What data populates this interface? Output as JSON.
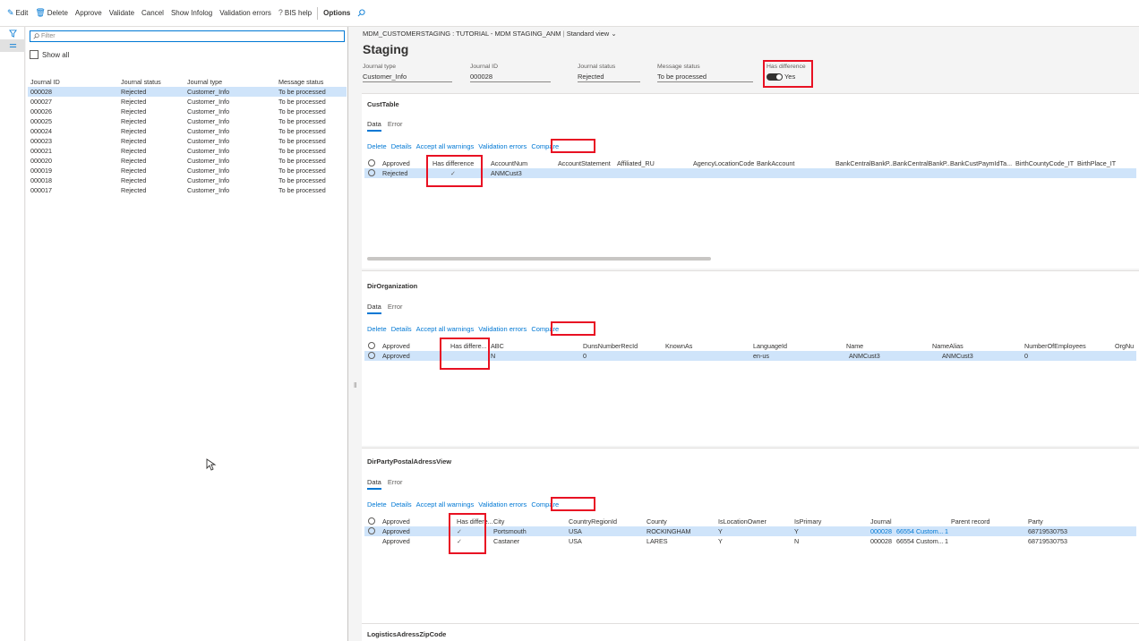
{
  "actions": {
    "edit": "Edit",
    "delete": "Delete",
    "approve": "Approve",
    "validate": "Validate",
    "cancel": "Cancel",
    "show_infolog": "Show Infolog",
    "validation_errors": "Validation errors",
    "bis_help": "BIS help",
    "options": "Options"
  },
  "list": {
    "filter_placeholder": "Filter",
    "show_all": "Show all",
    "columns": [
      "Journal ID",
      "Journal status",
      "Journal type",
      "Message status"
    ],
    "rows": [
      {
        "id": "000028",
        "status": "Rejected",
        "type": "Customer_Info",
        "message": "To be processed"
      },
      {
        "id": "000027",
        "status": "Rejected",
        "type": "Customer_Info",
        "message": "To be processed"
      },
      {
        "id": "000026",
        "status": "Rejected",
        "type": "Customer_Info",
        "message": "To be processed"
      },
      {
        "id": "000025",
        "status": "Rejected",
        "type": "Customer_Info",
        "message": "To be processed"
      },
      {
        "id": "000024",
        "status": "Rejected",
        "type": "Customer_Info",
        "message": "To be processed"
      },
      {
        "id": "000023",
        "status": "Rejected",
        "type": "Customer_Info",
        "message": "To be processed"
      },
      {
        "id": "000021",
        "status": "Rejected",
        "type": "Customer_Info",
        "message": "To be processed"
      },
      {
        "id": "000020",
        "status": "Rejected",
        "type": "Customer_Info",
        "message": "To be processed"
      },
      {
        "id": "000019",
        "status": "Rejected",
        "type": "Customer_Info",
        "message": "To be processed"
      },
      {
        "id": "000018",
        "status": "Rejected",
        "type": "Customer_Info",
        "message": "To be processed"
      },
      {
        "id": "000017",
        "status": "Rejected",
        "type": "Customer_Info",
        "message": "To be processed"
      }
    ]
  },
  "detail": {
    "breadcrumb": "MDM_CUSTOMERSTAGING : TUTORIAL - MDM STAGING_ANM",
    "view": "Standard view",
    "title": "Staging",
    "header": {
      "journal_type_label": "Journal type",
      "journal_type_value": "Customer_Info",
      "journal_id_label": "Journal ID",
      "journal_id_value": "000028",
      "journal_status_label": "Journal status",
      "journal_status_value": "Rejected",
      "message_status_label": "Message status",
      "message_status_value": "To be processed",
      "has_difference_label": "Has difference",
      "has_difference_value": "Yes"
    },
    "tab_data": "Data",
    "tab_error": "Error",
    "cmd_delete": "Delete",
    "cmd_details": "Details",
    "cmd_accept": "Accept all warnings",
    "cmd_validation": "Validation errors",
    "cmd_compare": "Compare",
    "check": "✓"
  },
  "cust": {
    "title": "CustTable",
    "headers": [
      "Approved",
      "Has difference",
      "AccountNum",
      "AccountStatement",
      "Affiliated_RU",
      "AgencyLocationCode",
      "BankAccount",
      "BankCentralBankP...",
      "BankCentralBankP...",
      "BankCustPaymIdTa...",
      "BirthCountyCode_IT",
      "BirthPlace_IT"
    ],
    "row": {
      "approved": "Rejected",
      "account": "ANMCust3"
    }
  },
  "org": {
    "title": "DirOrganization",
    "headers": [
      "Approved",
      "Has differe...",
      "ABC",
      "DunsNumberRecId",
      "KnownAs",
      "LanguageId",
      "Name",
      "NameAlias",
      "NumberOfEmployees",
      "OrgNu"
    ],
    "row": {
      "approved": "Approved",
      "abc": "N",
      "duns": "0",
      "lang": "en-us",
      "name": "ANMCust3",
      "alias": "ANMCust3",
      "employees": "0"
    }
  },
  "postal": {
    "title": "DirPartyPostalAdressView",
    "headers": [
      "Approved",
      "Has differe...",
      "City",
      "CountryRegionId",
      "County",
      "IsLocationOwner",
      "IsPrimary",
      "Journal",
      "Parent record",
      "Party"
    ],
    "rows": [
      {
        "approved": "Approved",
        "city": "Portsmouth",
        "country": "USA",
        "county": "ROCKINGHAM",
        "owner": "Y",
        "primary": "Y",
        "journal": "000028",
        "journal_desc": "66554 Custom...",
        "parent": "1",
        "party": "68719530753"
      },
      {
        "approved": "Approved",
        "city": "Castaner",
        "country": "USA",
        "county": "LARES",
        "owner": "Y",
        "primary": "N",
        "journal": "000028",
        "journal_desc": "66554 Custom...",
        "parent": "1",
        "party": "68719530753"
      }
    ]
  },
  "zip": {
    "title": "LogisticsAdressZipCode"
  }
}
